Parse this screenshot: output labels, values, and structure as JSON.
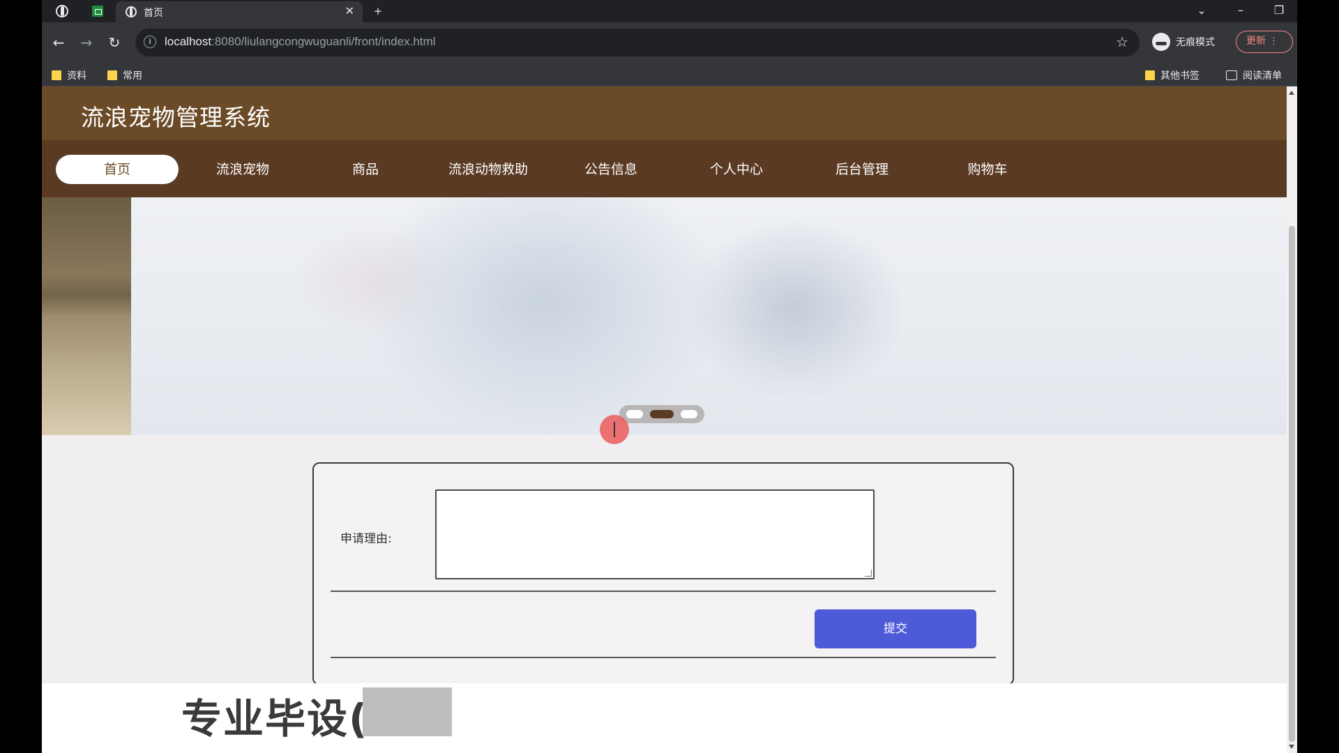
{
  "browser": {
    "tab_title": "首页",
    "url_host": "localhost",
    "url_rest": ":8080/liulangcongwuguanli/front/index.html",
    "incognito_label": "无痕模式",
    "update_label": "更新",
    "bookmarks": [
      "资料",
      "常用"
    ],
    "bookmarks_right": [
      "其他书签",
      "阅读清单"
    ]
  },
  "site": {
    "title": "流浪宠物管理系统",
    "nav": [
      "首页",
      "流浪宠物",
      "商品",
      "流浪动物救助",
      "公告信息",
      "个人中心",
      "后台管理",
      "购物车"
    ],
    "active_nav": "首页"
  },
  "carousel": {
    "slide_count": 3,
    "active_index": 1
  },
  "form": {
    "reason_label": "申请理由:",
    "reason_value": "",
    "submit_label": "提交"
  },
  "watermark": {
    "text": "专业毕设("
  },
  "colors": {
    "header": "#6b4a27",
    "nav": "#5a3a23",
    "submit": "#4e5bd8"
  }
}
